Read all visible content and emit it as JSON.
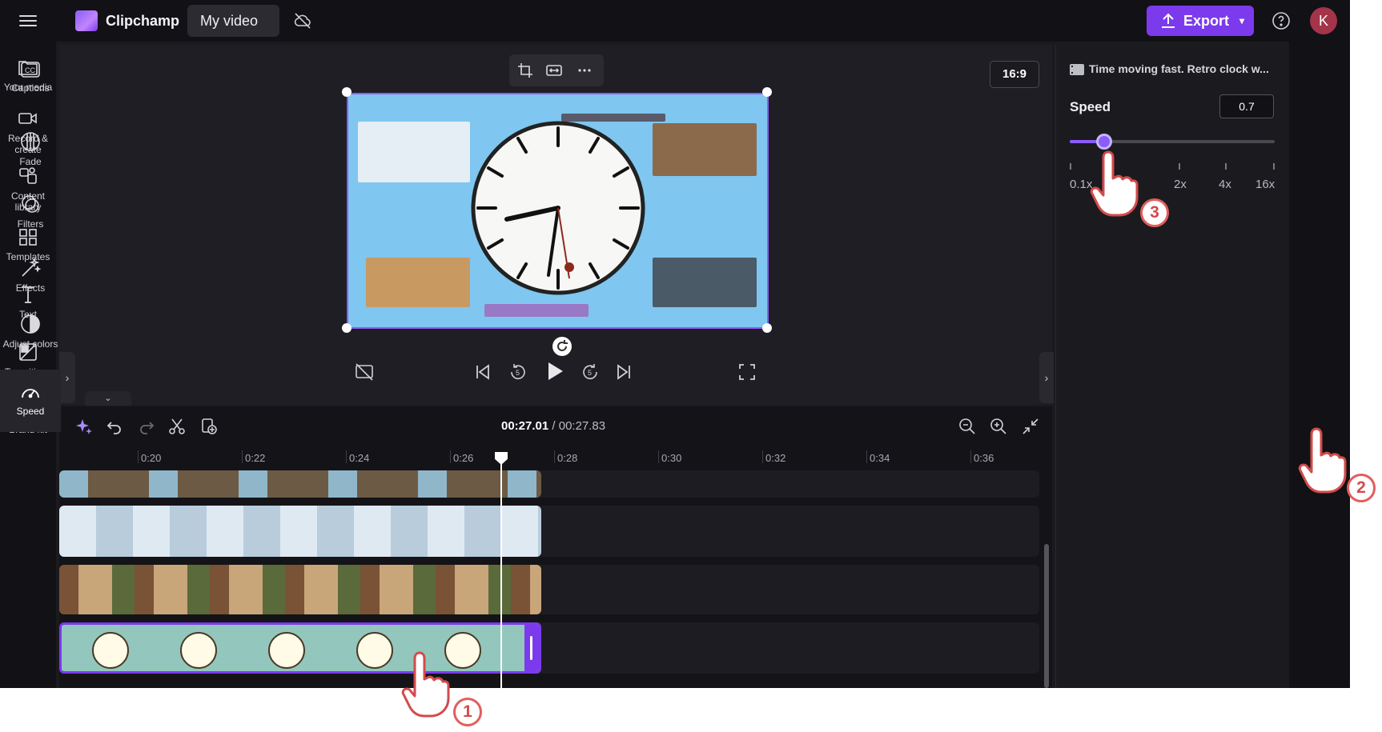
{
  "app": {
    "brand": "Clipchamp",
    "project_title": "My video"
  },
  "header": {
    "export_label": "Export",
    "avatar_initial": "K"
  },
  "left_sidebar": {
    "items": [
      {
        "label": "Your media",
        "icon": "folder-icon"
      },
      {
        "label": "Record & create",
        "icon": "camera-icon"
      },
      {
        "label": "Content library",
        "icon": "library-icon"
      },
      {
        "label": "Templates",
        "icon": "templates-icon"
      },
      {
        "label": "Text",
        "icon": "text-icon"
      },
      {
        "label": "Transitions",
        "icon": "transitions-icon"
      },
      {
        "label": "Brand kit",
        "icon": "brand-kit-icon"
      }
    ]
  },
  "preview": {
    "aspect_ratio": "16:9"
  },
  "timeline": {
    "current_time": "00:27.01",
    "total_time": "/ 00:27.83",
    "ruler_ticks": [
      "0:20",
      "0:22",
      "0:24",
      "0:26",
      "0:28",
      "0:30",
      "0:32",
      "0:34",
      "0:36"
    ]
  },
  "right_panel": {
    "clip_name": "Time moving fast. Retro clock w...",
    "speed_label": "Speed",
    "speed_value": "0.7",
    "speed_slider_fraction": 0.15,
    "scale_labels": [
      "0.1x",
      "2x",
      "4x",
      "16x"
    ]
  },
  "right_bar": {
    "items": [
      {
        "label": "Captions",
        "icon": "captions-icon"
      },
      {
        "label": "Fade",
        "icon": "fade-icon"
      },
      {
        "label": "Filters",
        "icon": "filters-icon"
      },
      {
        "label": "Effects",
        "icon": "effects-icon"
      },
      {
        "label": "Adjust colors",
        "icon": "adjust-colors-icon"
      },
      {
        "label": "Speed",
        "icon": "speed-icon"
      }
    ]
  },
  "annotations": {
    "step1": "1",
    "step2": "2",
    "step3": "3"
  },
  "colors": {
    "accent": "#7c3aed",
    "slider": "#8b5cf6",
    "badge_border": "#e35d5d"
  }
}
